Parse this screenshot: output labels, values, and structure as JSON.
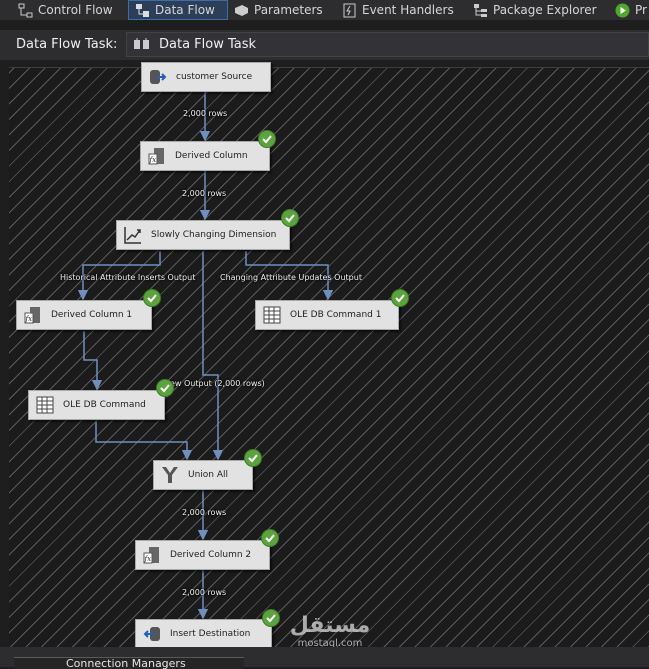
{
  "tabs": [
    {
      "label": "Control Flow",
      "active": false,
      "icon": "control-flow-icon"
    },
    {
      "label": "Data Flow",
      "active": true,
      "icon": "data-flow-icon"
    },
    {
      "label": "Parameters",
      "active": false,
      "icon": "parameters-icon"
    },
    {
      "label": "Event Handlers",
      "active": false,
      "icon": "event-handlers-icon"
    },
    {
      "label": "Package Explorer",
      "active": false,
      "icon": "package-explorer-icon"
    },
    {
      "label": "Pr",
      "active": false,
      "icon": "progress-icon"
    }
  ],
  "task": {
    "label": "Data Flow Task:",
    "selected": "Data Flow Task",
    "icon": "data-flow-task-icon"
  },
  "components": {
    "customer_source": {
      "label": "customer Source",
      "icon": "source-icon",
      "validated": false
    },
    "derived_column": {
      "label": "Derived Column",
      "icon": "derived-column-icon",
      "validated": true
    },
    "scd": {
      "label": "Slowly Changing Dimension",
      "icon": "scd-icon",
      "validated": true
    },
    "derived_column_1": {
      "label": "Derived Column 1",
      "icon": "derived-column-icon",
      "validated": true
    },
    "ole_db_command_1": {
      "label": "OLE DB Command 1",
      "icon": "ole-db-command-icon",
      "validated": true
    },
    "ole_db_command": {
      "label": "OLE DB Command",
      "icon": "ole-db-command-icon",
      "validated": true
    },
    "union_all": {
      "label": "Union All",
      "icon": "union-all-icon",
      "validated": true
    },
    "derived_column_2": {
      "label": "Derived Column 2",
      "icon": "derived-column-icon",
      "validated": true
    },
    "insert_destination": {
      "label": "Insert Destination",
      "icon": "destination-icon",
      "validated": true
    }
  },
  "path_labels": {
    "source_to_derived": "2,000 rows",
    "derived_to_scd": "2,000 rows",
    "historical": "Historical Attribute Inserts Output",
    "changing": "Changing Attribute Updates Output",
    "new_output": "ew Output (2,000 rows)",
    "union_to_derived2": "2,000 rows",
    "derived2_to_dest": "2,000 rows"
  },
  "bottom": {
    "connection_managers": "Connection Managers"
  },
  "watermark": {
    "arabic": "مستقل",
    "latin": "mostaql.com"
  },
  "colors": {
    "path": "#6f8fbf",
    "check": "#5ca33f",
    "active_tab": "#2d3e58"
  }
}
